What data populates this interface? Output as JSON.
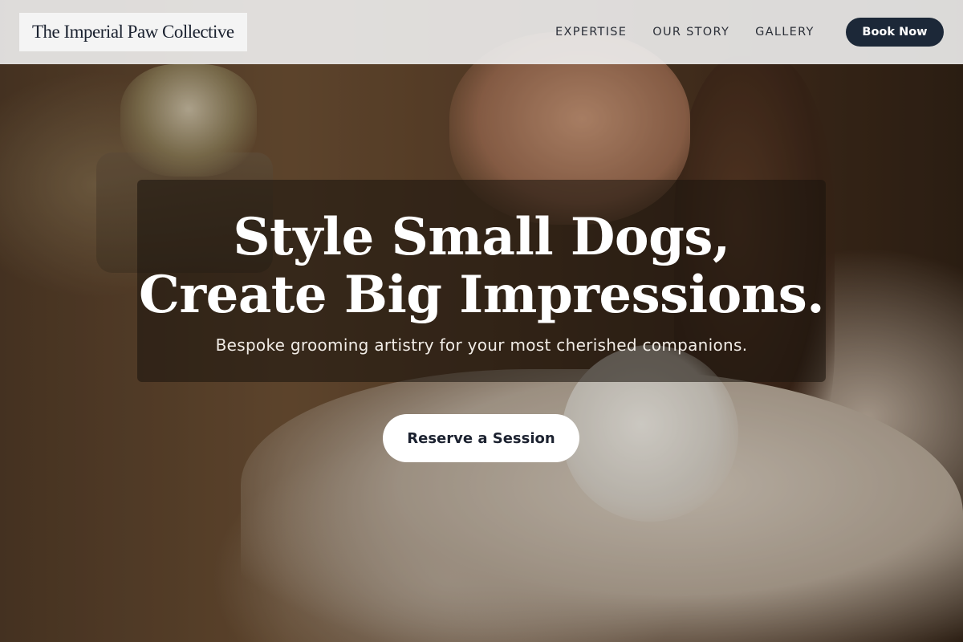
{
  "brand": {
    "name": "The Imperial Paw Collective"
  },
  "nav": {
    "links": [
      "EXPERTISE",
      "OUR STORY",
      "GALLERY"
    ],
    "cta": "Book Now"
  },
  "hero": {
    "headline_line1": "Style Small Dogs,",
    "headline_line2": "Create Big Impressions.",
    "subtitle": "Bespoke grooming artistry for your most cherished companions.",
    "cta": "Reserve a Session"
  },
  "colors": {
    "navy": "#1c2838",
    "white": "#ffffff",
    "nav_background": "#eeeeee"
  }
}
